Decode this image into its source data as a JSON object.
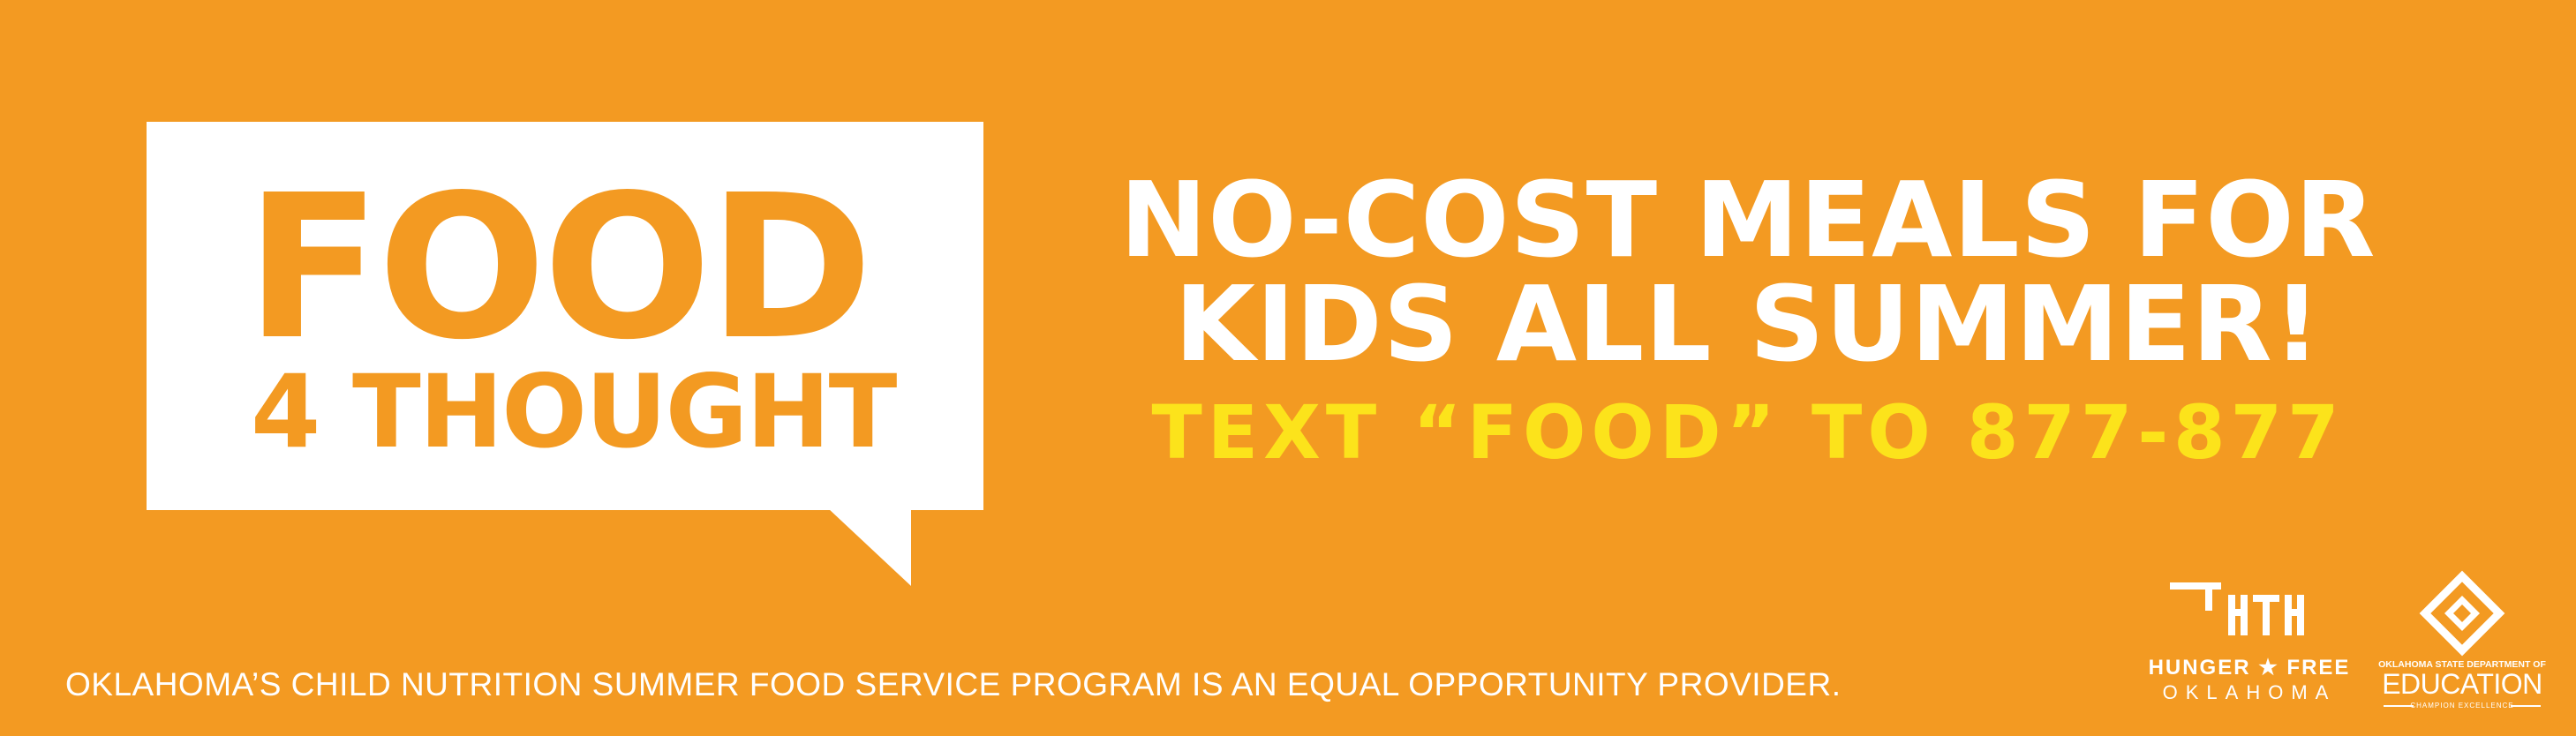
{
  "colors": {
    "background": "#F39A22",
    "bubble": "#FFFFFF",
    "headline": "#FFFFFF",
    "cta": "#FCE31B"
  },
  "logo": {
    "line1": "FOOD",
    "line2": "4 THOUGHT"
  },
  "headline": {
    "line1": "NO-COST MEALS FOR",
    "line2": "KIDS ALL SUMMER!"
  },
  "cta": "TEXT “FOOD” TO 877-877",
  "footer": "OKLAHOMA’S CHILD NUTRITION SUMMER FOOD SERVICE PROGRAM IS AN EQUAL OPPORTUNITY PROVIDER.",
  "partners": {
    "hunger_free": {
      "line1": "HUNGER ★ FREE",
      "line2": "OKLAHOMA",
      "icon": "hunger-free-oklahoma-logo"
    },
    "education": {
      "top": "OKLAHOMA STATE DEPARTMENT OF",
      "main": "EDUCATION",
      "tagline": "CHAMPION EXCELLENCE",
      "icon": "oklahoma-education-logo"
    }
  }
}
